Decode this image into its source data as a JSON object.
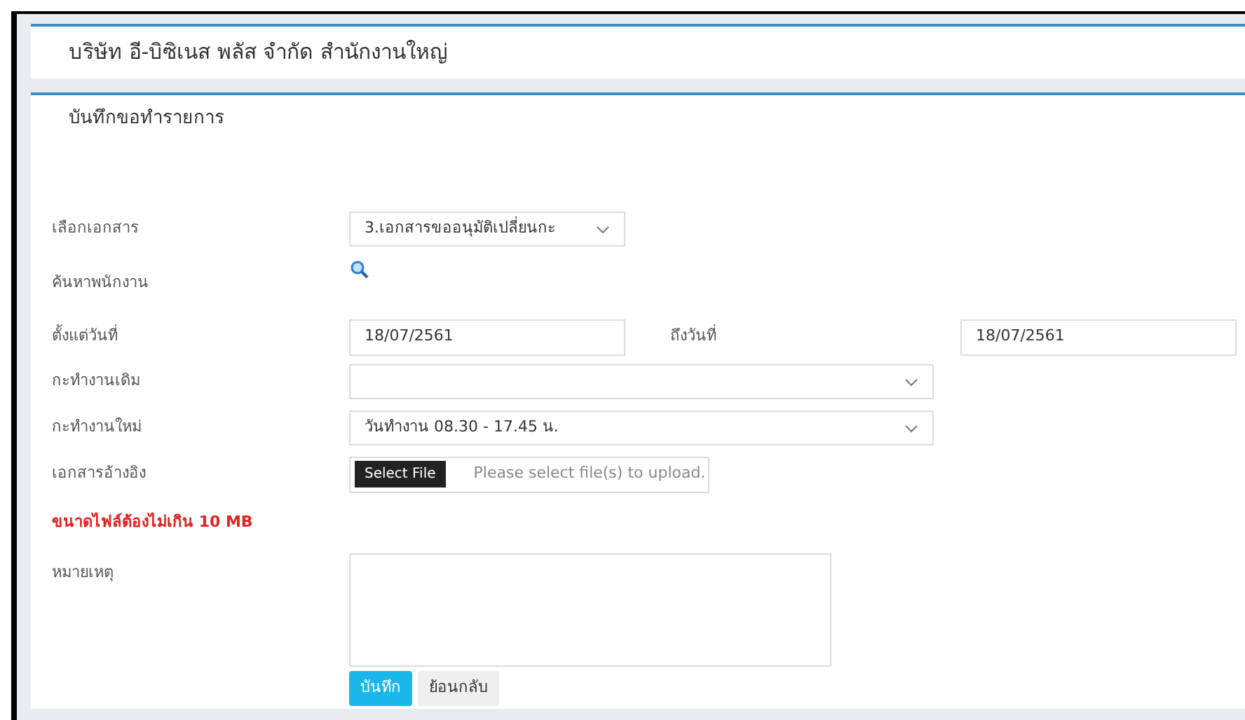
{
  "header": {
    "title": "บริษัท อี-บิซิเนส พลัส จำกัด สำนักงานใหญ่"
  },
  "panel": {
    "title": "บันทึกขอทำรายการ"
  },
  "fields": [
    {
      "kind": "short_select",
      "label": "เลือกเอกสาร",
      "value": "3.เอกสารขออนุมัติเปลี่ยนกะ"
    },
    {
      "kind": "search",
      "label": "ค้นหาพนักงาน"
    },
    {
      "kind": "daterange",
      "label": "ตั้งแต่วันที่",
      "value": "18/07/2561",
      "label_2": "ถึงวันที่",
      "value_2": "18/07/2561"
    },
    {
      "kind": "select",
      "label": "กะทำงานเดิม"
    },
    {
      "kind": "select",
      "label": "กะทำงานใหม่",
      "value": "วันทำงาน 08.30 - 17.45 น."
    },
    {
      "kind": "file",
      "label": "เอกสารอ้างอิง",
      "button": "Select File",
      "placeholder": "Please select file(s) to upload."
    },
    {
      "kind": "note",
      "label": "ขนาดไฟล์ต้องไม่เกิน 10 MB"
    },
    {
      "kind": "textarea",
      "label": "หมายเหตุ"
    }
  ],
  "buttons": [
    {
      "label": "บันทึก",
      "kind": "primary"
    },
    {
      "label": "ย้อนกลับ",
      "kind": "secondary"
    }
  ]
}
